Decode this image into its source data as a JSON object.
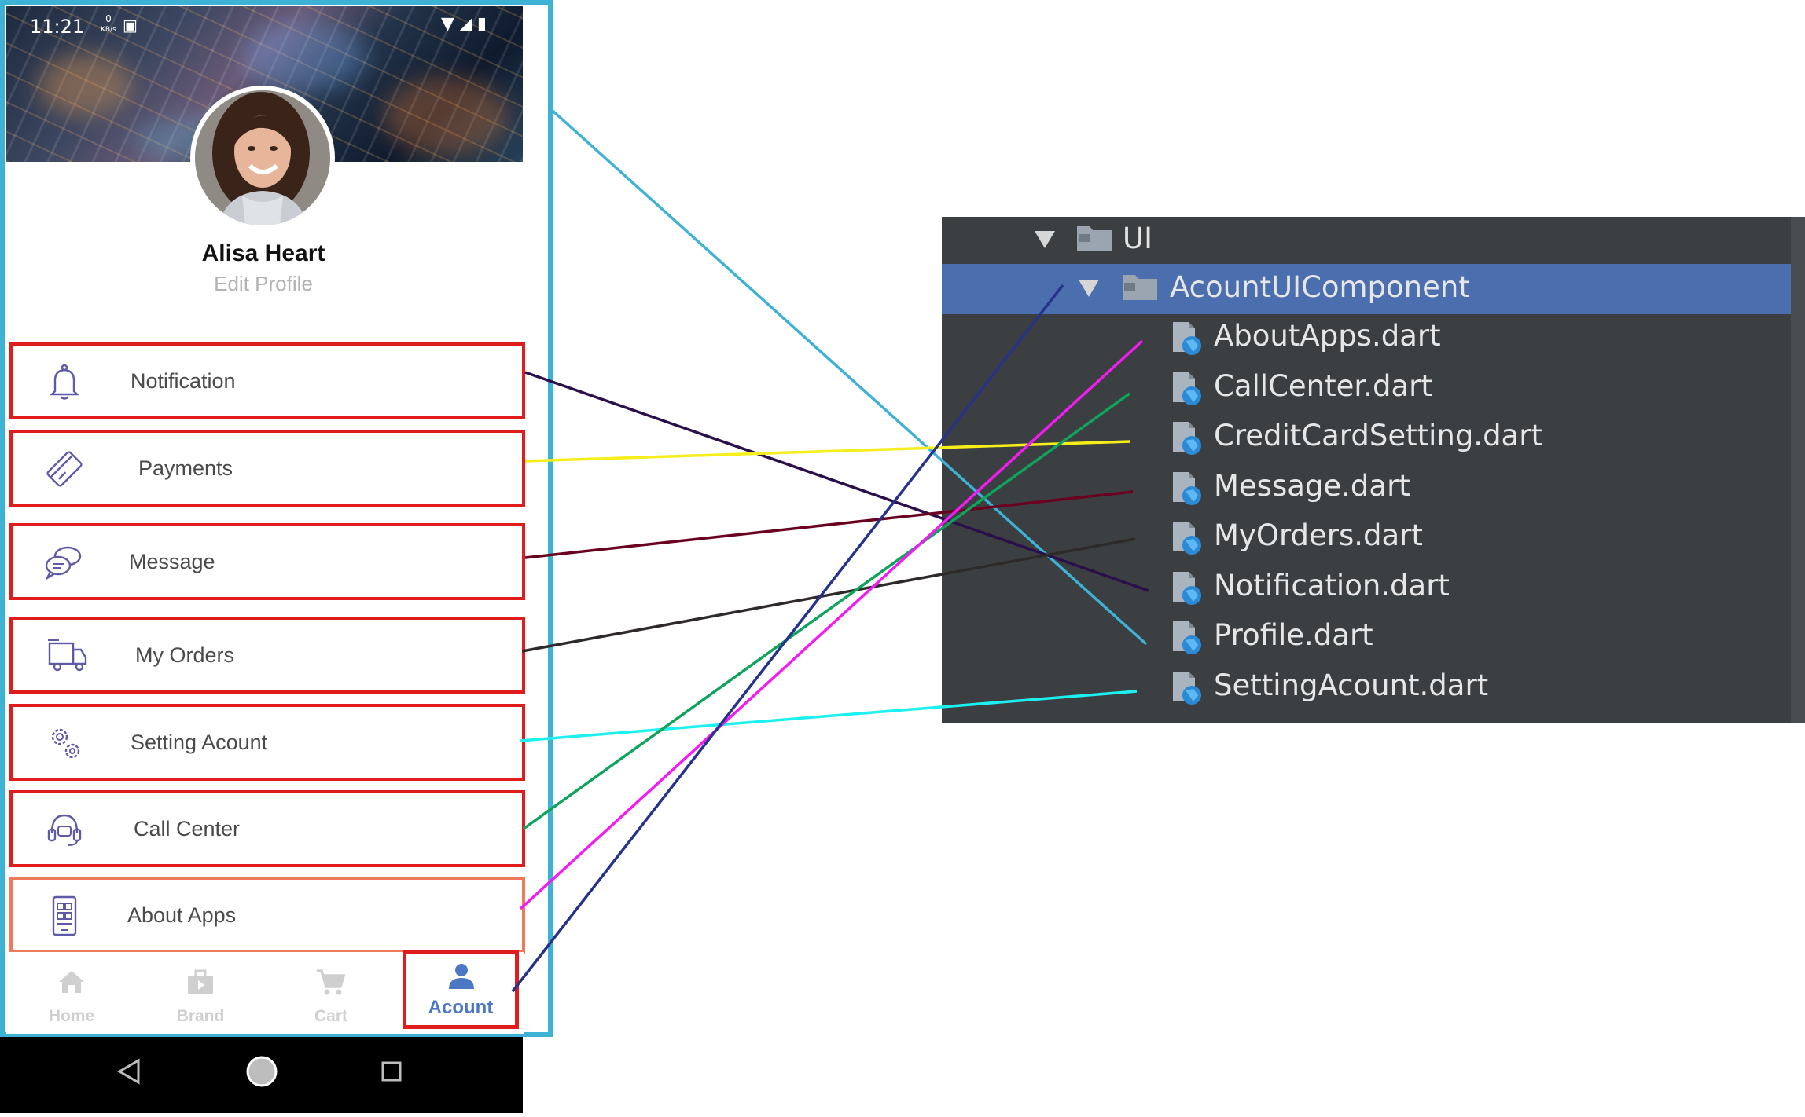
{
  "status": {
    "time": "11:21",
    "net": "0 KB/s"
  },
  "profile": {
    "name": "Alisa Heart",
    "edit_label": "Edit Profile"
  },
  "menu": [
    {
      "label": "Notification",
      "icon": "bell-icon"
    },
    {
      "label": "Payments",
      "icon": "credit-card-icon"
    },
    {
      "label": "Message",
      "icon": "chat-bubbles-icon"
    },
    {
      "label": "My Orders",
      "icon": "delivery-truck-icon"
    },
    {
      "label": "Setting Acount",
      "icon": "gears-icon"
    },
    {
      "label": "Call Center",
      "icon": "headset-icon"
    },
    {
      "label": "About Apps",
      "icon": "phone-app-icon"
    }
  ],
  "bottom_nav": [
    {
      "label": "Home",
      "icon": "home-icon"
    },
    {
      "label": "Brand",
      "icon": "brand-bag-icon"
    },
    {
      "label": "Cart",
      "icon": "cart-icon"
    },
    {
      "label": "Acount",
      "icon": "person-icon",
      "active": true
    }
  ],
  "tree": {
    "root": "UI",
    "folder": "AcountUIComponent",
    "files": [
      "AboutApps.dart",
      "CallCenter.dart",
      "CreditCardSetting.dart",
      "Message.dart",
      "MyOrders.dart",
      "Notification.dart",
      "Profile.dart",
      "SettingAcount.dart"
    ]
  },
  "colors": {
    "phone_frame": "#3db2d4",
    "highlight_box": "#e01c1c",
    "ide_background": "#3c3f41",
    "ide_selection": "#4b6eaf",
    "nav_active": "#4b77c4"
  }
}
